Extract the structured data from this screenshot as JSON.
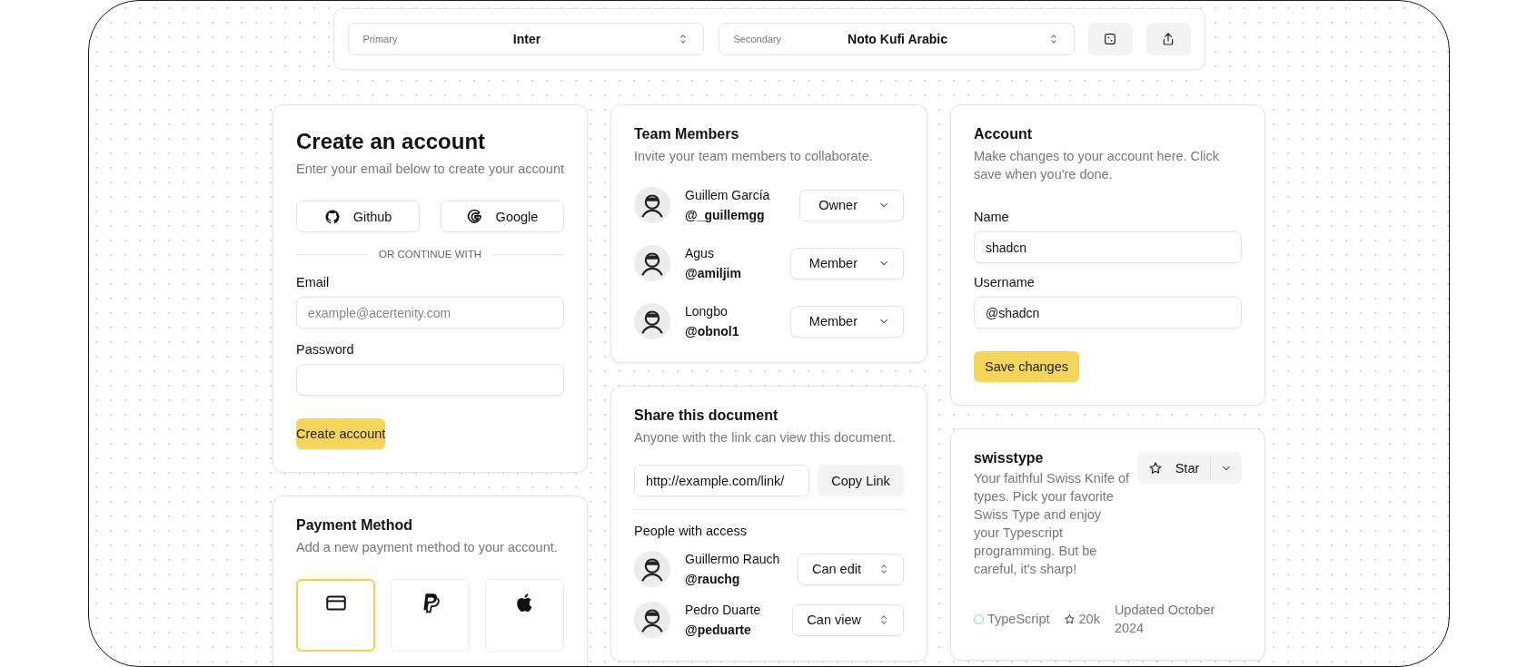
{
  "toolbar": {
    "primary": {
      "label": "Primary",
      "value": "Inter"
    },
    "secondary": {
      "label": "Secondary",
      "value": "Noto Kufi Arabic"
    }
  },
  "create_account": {
    "title": "Create an account",
    "subtitle": "Enter your email below to create your account",
    "social_buttons": [
      {
        "kind": "github",
        "label": "Github"
      },
      {
        "kind": "google",
        "label": "Google"
      }
    ],
    "divider": "OR CONTINUE WITH",
    "email": {
      "label": "Email",
      "placeholder": "example@acertenity.com"
    },
    "password": {
      "label": "Password"
    },
    "submit": "Create account"
  },
  "payment_method": {
    "title": "Payment Method",
    "subtitle": "Add a new payment method to your account.",
    "options": [
      {
        "kind": "card",
        "selected": true
      },
      {
        "kind": "paypal",
        "selected": false
      },
      {
        "kind": "apple",
        "selected": false
      }
    ]
  },
  "team_members": {
    "title": "Team Members",
    "subtitle": "Invite your team members to collaborate.",
    "members": [
      {
        "name": "Guillem García",
        "handle": "@_guillemgg",
        "role": "Owner"
      },
      {
        "name": "Agus",
        "handle": "@amiljim",
        "role": "Member"
      },
      {
        "name": "Longbo",
        "handle": "@obnol1",
        "role": "Member"
      }
    ]
  },
  "share_document": {
    "title": "Share this document",
    "subtitle": "Anyone with the link can view this document.",
    "link": "http://example.com/link/",
    "copy_button": "Copy Link",
    "people_heading": "People with access",
    "people": [
      {
        "name": "Guillermo Rauch",
        "handle": "@rauchg",
        "permission": "Can edit"
      },
      {
        "name": "Pedro Duarte",
        "handle": "@peduarte",
        "permission": "Can view"
      }
    ]
  },
  "account": {
    "title": "Account",
    "subtitle": "Make changes to your account here. Click save when you're done.",
    "fields": [
      {
        "label": "Name",
        "value": "shadcn"
      },
      {
        "label": "Username",
        "value": "@shadcn"
      }
    ],
    "save_button": "Save changes"
  },
  "repo": {
    "name": "swisstype",
    "description": "Your faithful Swiss Knife of types. Pick your favorite Swiss Type and enjoy your Typescript programming. But be careful, it's sharp!",
    "star_button": "Star",
    "language": "TypeScript",
    "star_count": "20k",
    "updated": "Updated October 2024"
  }
}
